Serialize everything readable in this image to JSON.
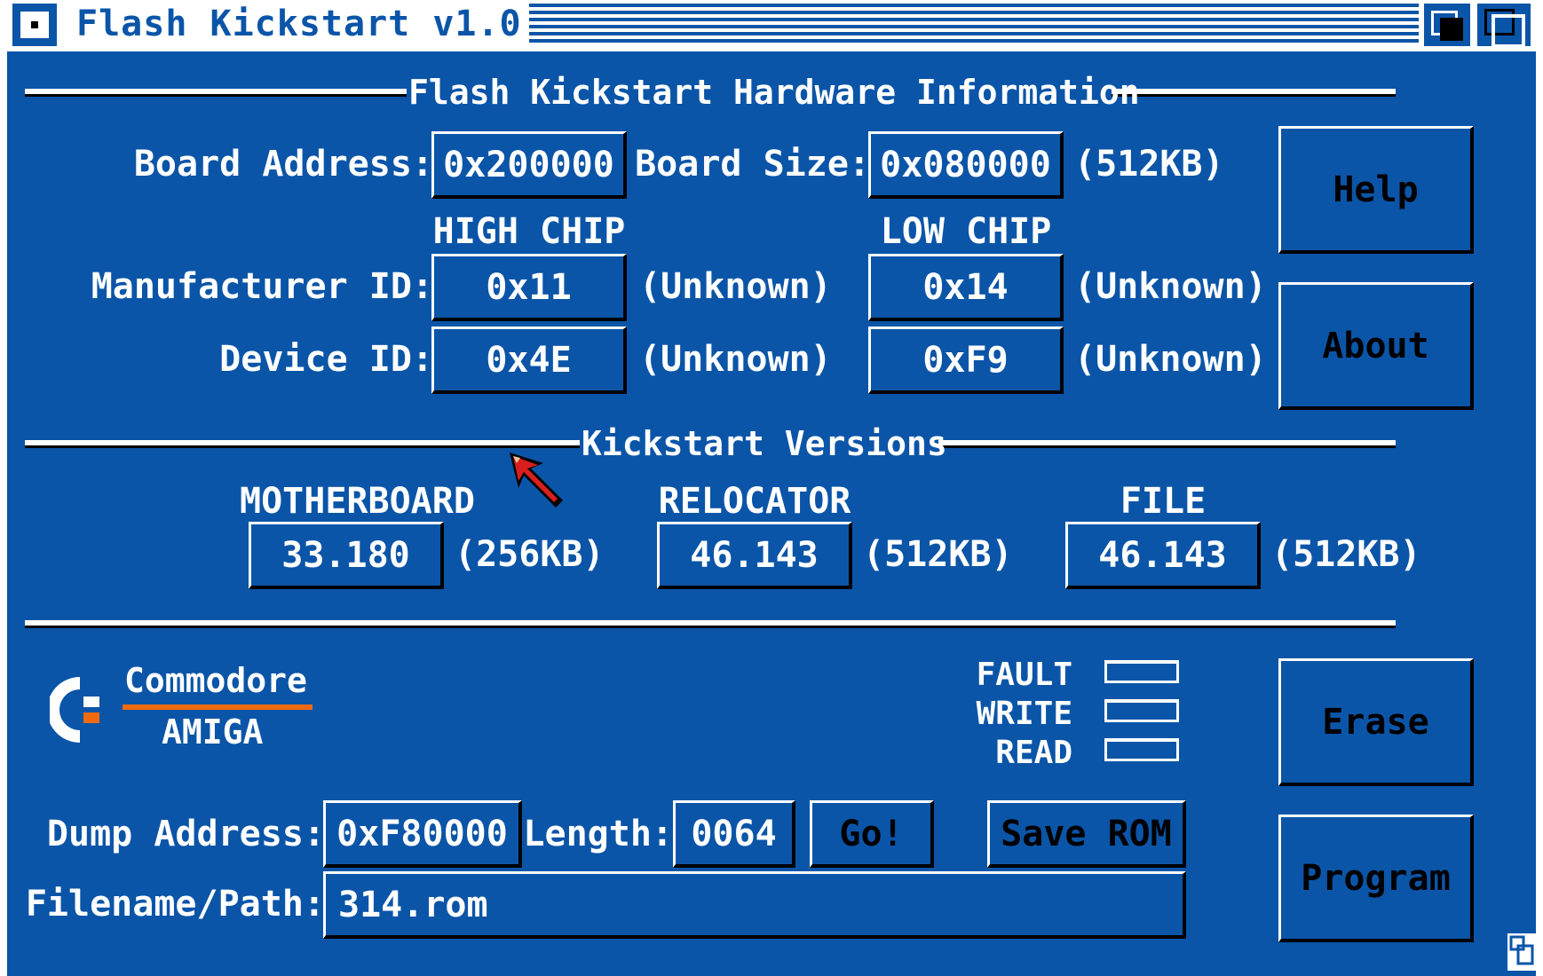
{
  "window": {
    "title": "Flash Kickstart v1.0",
    "bg_color": "#0b55a8"
  },
  "hardware": {
    "section_title": "Flash Kickstart Hardware Information",
    "board_address_label": "Board Address:",
    "board_address_value": "0x200000",
    "board_size_label": "Board Size:",
    "board_size_value": "0x080000",
    "board_size_note": "(512KB)",
    "high_chip_label": "HIGH CHIP",
    "low_chip_label": "LOW CHIP",
    "manufacturer_label": "Manufacturer ID:",
    "device_label": "Device ID:",
    "high_manufacturer_value": "0x11",
    "high_manufacturer_note": "(Unknown)",
    "low_manufacturer_value": "0x14",
    "low_manufacturer_note": "(Unknown)",
    "high_device_value": "0x4E",
    "high_device_note": "(Unknown)",
    "low_device_value": "0xF9",
    "low_device_note": "(Unknown)"
  },
  "versions": {
    "section_title": "Kickstart Versions",
    "motherboard_label": "MOTHERBOARD",
    "motherboard_value": "33.180",
    "motherboard_size": "(256KB)",
    "relocator_label": "RELOCATOR",
    "relocator_value": "46.143",
    "relocator_size": "(512KB)",
    "file_label": "FILE",
    "file_value": "46.143",
    "file_size": "(512KB)"
  },
  "buttons": {
    "help": "Help",
    "about": "About",
    "erase": "Erase",
    "program": "Program",
    "go": "Go!",
    "save_rom": "Save ROM"
  },
  "logo": {
    "top": "Commodore",
    "bottom": "AMIGA",
    "accent_color": "#f06a10"
  },
  "indicators": {
    "fault": "FAULT",
    "write": "WRITE",
    "read": "READ"
  },
  "dump": {
    "address_label": "Dump Address:",
    "address_value": "0xF80000",
    "length_label": "Length:",
    "length_value": "0064",
    "filename_label": "Filename/Path:",
    "filename_value": "314.rom"
  }
}
